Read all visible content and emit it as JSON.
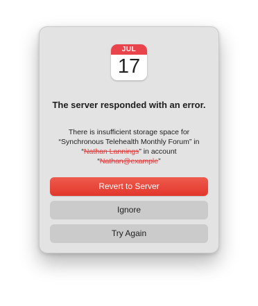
{
  "icon": {
    "name": "calendar-icon",
    "month": "JUL",
    "day": "17"
  },
  "alert": {
    "title": "The server responded with an error.",
    "message_pre": "There is insufficient storage space for “Synchronous Telehealth Monthly Forum” in “",
    "message_redacted_1": "Nathan Lannings",
    "message_mid": "” in account “",
    "message_redacted_2": "Nathan@example",
    "message_post": "”"
  },
  "buttons": {
    "primary": "Revert to Server",
    "ignore": "Ignore",
    "retry": "Try Again"
  },
  "colors": {
    "primary": "#e2372b",
    "calendar_header": "#e9444b",
    "redaction": "#e23a3a"
  }
}
